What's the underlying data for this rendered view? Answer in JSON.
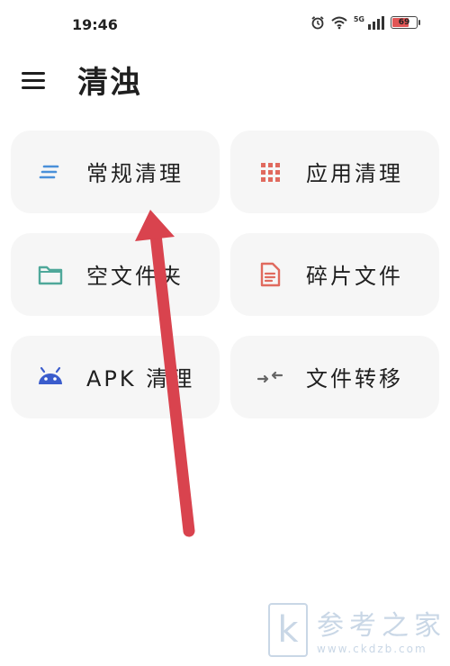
{
  "status_bar": {
    "time": "19:46",
    "battery_level": "69",
    "network": "5G",
    "icons": [
      "alarm-icon",
      "wifi-icon",
      "signal-icon",
      "battery-icon"
    ]
  },
  "header": {
    "title": "清浊",
    "menu_icon": "hamburger-menu-icon"
  },
  "cards": [
    {
      "label": "常规清理",
      "icon": "lines-icon",
      "color": "#4a90d9"
    },
    {
      "label": "应用清理",
      "icon": "grid-icon",
      "color": "#e06a5e"
    },
    {
      "label": "空文件夹",
      "icon": "folder-icon",
      "color": "#4fa89a"
    },
    {
      "label": "碎片文件",
      "icon": "document-icon",
      "color": "#e06a5e"
    },
    {
      "label": "APK 清理",
      "icon": "android-icon",
      "color": "#3a5ccc"
    },
    {
      "label": "文件转移",
      "icon": "transfer-icon",
      "color": "#666666"
    }
  ],
  "overlay": {
    "arrow_color": "#d9434e"
  },
  "watermark": {
    "logo_letter": "k",
    "text": "参考之家",
    "url": "www.ckdzb.com"
  }
}
